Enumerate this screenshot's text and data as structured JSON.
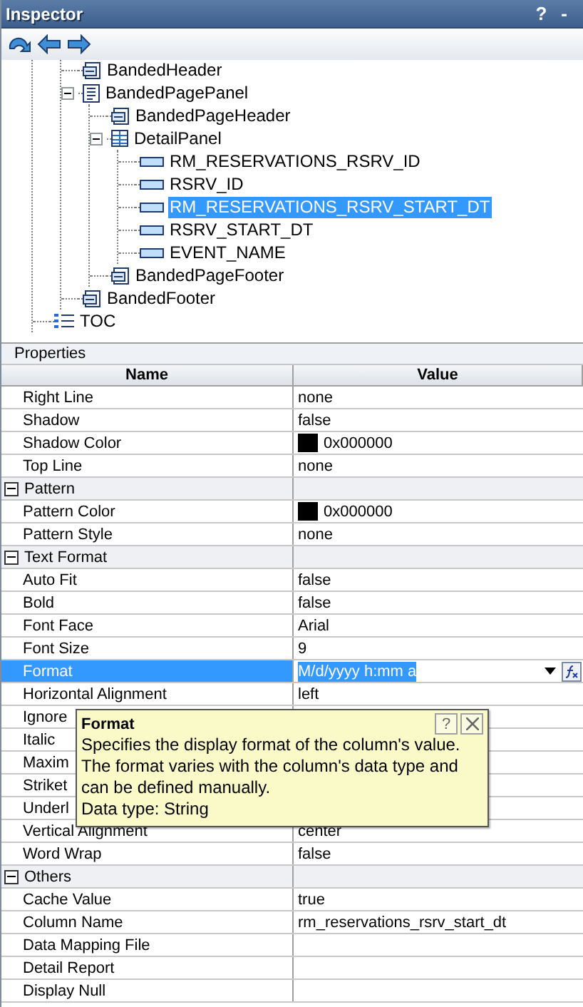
{
  "window": {
    "title": "Inspector",
    "help": "?",
    "minimize": "-"
  },
  "tree": [
    {
      "children": [
        {
          "children": [
            {
              "label": "BandedHeader",
              "kind": "band",
              "selected": false
            },
            {
              "label": "BandedPagePanel",
              "kind": "page",
              "expanded": true,
              "selected": false,
              "children": [
                {
                  "label": "BandedPageHeader",
                  "kind": "band",
                  "selected": false
                },
                {
                  "label": "DetailPanel",
                  "kind": "grid",
                  "expanded": true,
                  "selected": false,
                  "children": [
                    {
                      "label": "RM_RESERVATIONS_RSRV_ID",
                      "kind": "field",
                      "selected": false
                    },
                    {
                      "label": "RSRV_ID",
                      "kind": "field",
                      "selected": false
                    },
                    {
                      "label": "RM_RESERVATIONS_RSRV_START_DT",
                      "kind": "field",
                      "selected": true
                    },
                    {
                      "label": "RSRV_START_DT",
                      "kind": "field",
                      "selected": false
                    },
                    {
                      "label": "EVENT_NAME",
                      "kind": "field",
                      "selected": false
                    }
                  ]
                },
                {
                  "label": "BandedPageFooter",
                  "kind": "band",
                  "selected": false
                }
              ]
            },
            {
              "label": "BandedFooter",
              "kind": "band",
              "selected": false
            }
          ]
        },
        {
          "label": "TOC",
          "kind": "toc",
          "selected": false
        }
      ]
    }
  ],
  "properties": {
    "title": "Properties",
    "columns": [
      "Name",
      "Value"
    ],
    "rows": [
      {
        "kind": "prop",
        "name": "Right Line",
        "value": "none",
        "selected": false
      },
      {
        "kind": "prop",
        "name": "Shadow",
        "value": "false",
        "selected": false
      },
      {
        "kind": "color",
        "name": "Shadow Color",
        "value": "0x000000",
        "color": "#000000",
        "selected": false
      },
      {
        "kind": "prop",
        "name": "Top Line",
        "value": "none",
        "selected": false
      },
      {
        "kind": "group",
        "name": "Pattern",
        "expanded": true
      },
      {
        "kind": "color",
        "name": "Pattern Color",
        "value": "0x000000",
        "color": "#000000",
        "selected": false
      },
      {
        "kind": "prop",
        "name": "Pattern Style",
        "value": "none",
        "selected": false
      },
      {
        "kind": "group",
        "name": "Text Format",
        "expanded": true
      },
      {
        "kind": "prop",
        "name": "Auto Fit",
        "value": "false",
        "selected": false
      },
      {
        "kind": "prop",
        "name": "Bold",
        "value": "false",
        "selected": false
      },
      {
        "kind": "prop",
        "name": "Font Face",
        "value": "Arial",
        "selected": false
      },
      {
        "kind": "prop",
        "name": "Font Size",
        "value": "9",
        "selected": false
      },
      {
        "kind": "edit",
        "name": "Format",
        "value": "M/d/yyyy h:mm a",
        "selected": true
      },
      {
        "kind": "prop",
        "name": "Horizontal Alignment",
        "value": "left",
        "selected": false
      },
      {
        "kind": "prop",
        "name": "Ignore",
        "selected": false
      },
      {
        "kind": "prop",
        "name": "Italic",
        "selected": false
      },
      {
        "kind": "prop",
        "name": "Maxim",
        "selected": false
      },
      {
        "kind": "prop",
        "name": "Striket",
        "selected": false
      },
      {
        "kind": "prop",
        "name": "Underl",
        "selected": false
      },
      {
        "kind": "prop",
        "name": "Vertical Alignment",
        "value": "center",
        "selected": false
      },
      {
        "kind": "prop",
        "name": "Word Wrap",
        "value": "false",
        "selected": false
      },
      {
        "kind": "group",
        "name": "Others",
        "expanded": true
      },
      {
        "kind": "prop",
        "name": "Cache Value",
        "value": "true",
        "selected": false
      },
      {
        "kind": "prop",
        "name": "Column Name",
        "value": "rm_reservations_rsrv_start_dt",
        "selected": false
      },
      {
        "kind": "prop",
        "name": "Data Mapping File",
        "selected": false
      },
      {
        "kind": "prop",
        "name": "Detail Report",
        "selected": false
      },
      {
        "kind": "prop",
        "name": "Display Null",
        "selected": false
      }
    ]
  },
  "tooltip": {
    "title": "Format",
    "help": "?",
    "description": "Specifies the display format of the column's value. The format varies with the column's data type and can be defined manually.",
    "data_type": "Data type: String"
  }
}
